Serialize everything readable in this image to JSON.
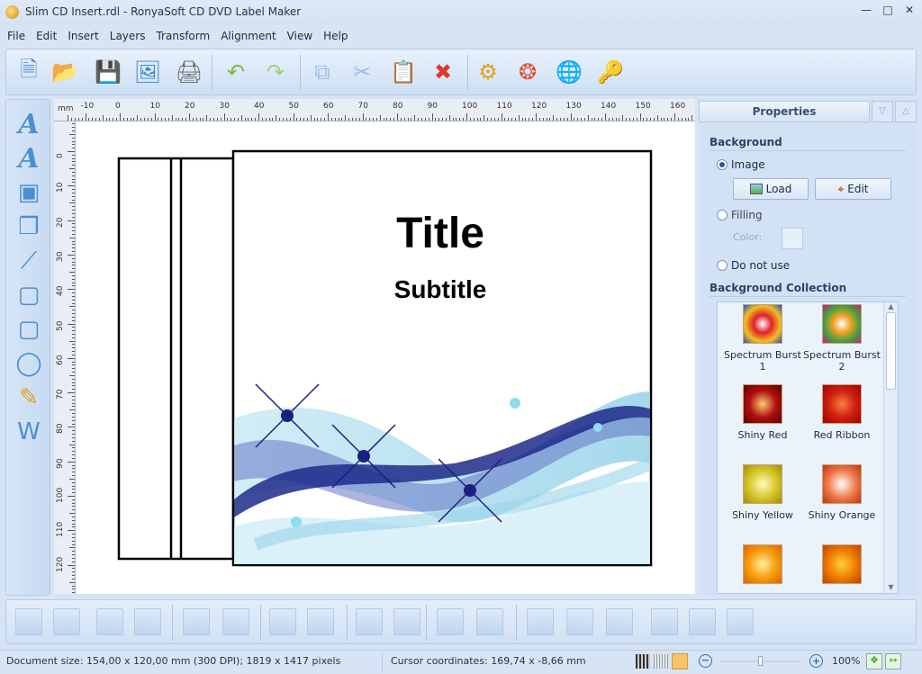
{
  "window": {
    "title": "Slim CD Insert.rdl - RonyaSoft CD DVD Label Maker"
  },
  "menu": [
    "File",
    "Edit",
    "Insert",
    "Layers",
    "Transform",
    "Alignment",
    "View",
    "Help"
  ],
  "toolbar": [
    {
      "icon": "new-document-icon"
    },
    {
      "icon": "open-folder-icon"
    },
    {
      "icon": "save-icon"
    },
    {
      "icon": "save-as-image-icon"
    },
    {
      "icon": "print-icon"
    },
    {
      "icon": "undo-icon"
    },
    {
      "icon": "redo-icon"
    },
    {
      "icon": "copy-icon"
    },
    {
      "icon": "cut-icon"
    },
    {
      "icon": "paste-icon"
    },
    {
      "icon": "delete-icon"
    },
    {
      "icon": "settings-icon"
    },
    {
      "icon": "help-lifebuoy-icon"
    },
    {
      "icon": "web-globe-icon"
    },
    {
      "icon": "key-icon"
    }
  ],
  "left_tools": [
    "text-icon",
    "curved-text-icon",
    "image-icon",
    "clipart-icon",
    "line-icon",
    "rectangle-icon",
    "rounded-rectangle-icon",
    "ellipse-icon",
    "pencil-icon",
    "word-import-icon"
  ],
  "ruler": {
    "unit": "mm",
    "h_labels": [
      "-10",
      "0",
      "10",
      "20",
      "30",
      "40",
      "50",
      "60",
      "70",
      "80",
      "90",
      "100",
      "110",
      "120",
      "130",
      "140",
      "150",
      "160"
    ],
    "v_labels": [
      "0",
      "10",
      "20",
      "30",
      "40",
      "50",
      "60",
      "70",
      "80",
      "90",
      "100",
      "110",
      "120"
    ]
  },
  "canvas": {
    "title": "Title",
    "subtitle": "Subtitle"
  },
  "properties": {
    "header": "Properties",
    "background_section": "Background",
    "image_label": "Image",
    "load_label": "Load",
    "edit_label": "Edit",
    "filling_label": "Filling",
    "color_label": "Color:",
    "fill_color": "#e3f1fb",
    "not_use_label": "Do not use",
    "selected": "Image",
    "collection_section": "Background Collection",
    "collection": [
      {
        "name": "Spectrum Burst 1",
        "colors": [
          "#ffffff",
          "#e0202a",
          "#f2c020",
          "#2050c0"
        ]
      },
      {
        "name": "Spectrum Burst 2",
        "colors": [
          "#ffffff",
          "#f0a020",
          "#40a040",
          "#c02080"
        ]
      },
      {
        "name": "Shiny Red",
        "colors": [
          "#f8d070",
          "#b01010",
          "#600000"
        ]
      },
      {
        "name": "Red Ribbon",
        "colors": [
          "#f88040",
          "#d02010",
          "#a00000"
        ]
      },
      {
        "name": "Shiny Yellow",
        "colors": [
          "#fffbc0",
          "#d8c830",
          "#a09000"
        ]
      },
      {
        "name": "Shiny Orange",
        "colors": [
          "#ffffff",
          "#f08050",
          "#c03010"
        ]
      },
      {
        "name": "",
        "colors": [
          "#fff0a0",
          "#f8a010",
          "#e06000"
        ]
      },
      {
        "name": "",
        "colors": [
          "#ffd040",
          "#f08000",
          "#c04000"
        ]
      }
    ]
  },
  "bottom_toolbar": [
    "bring-to-front-icon",
    "bring-forward-icon",
    "send-backward-icon",
    "send-to-back-icon",
    "group-icon",
    "ungroup-icon",
    "same-width-icon",
    "same-height-icon",
    "rotate-left-icon",
    "rotate-right-icon",
    "flip-horizontal-icon",
    "flip-vertical-icon",
    "align-left-icon",
    "align-center-icon",
    "align-right-icon",
    "align-top-icon",
    "align-middle-icon",
    "align-bottom-icon"
  ],
  "status": {
    "doc_size": "Document size: 154,00 x 120,00 mm (300 DPI); 1819 x 1417 pixels",
    "cursor": "Cursor coordinates: 169,74 x -8,66 mm",
    "zoom": "100%",
    "zoom_slider_fraction": 0.5
  }
}
